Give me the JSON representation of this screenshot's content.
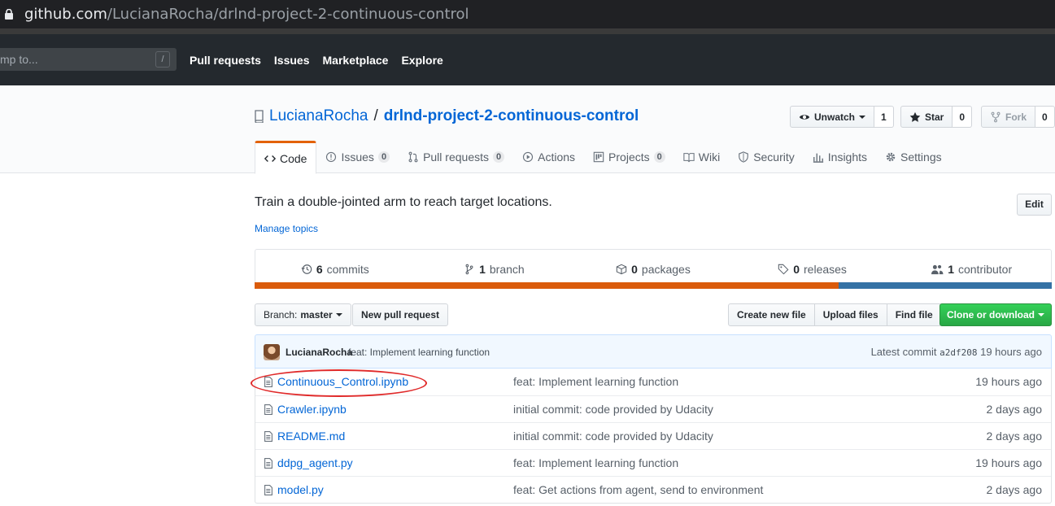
{
  "browser": {
    "url_host": "github.com",
    "url_path": "/LucianaRocha/drlnd-project-2-continuous-control"
  },
  "header": {
    "search_placeholder": "mp to...",
    "search_shortcut": "/",
    "nav": [
      "Pull requests",
      "Issues",
      "Marketplace",
      "Explore"
    ]
  },
  "repo": {
    "owner": "LucianaRocha",
    "separator": "/",
    "name": "drlnd-project-2-continuous-control",
    "unwatch_label": "Unwatch",
    "watch_count": "1",
    "star_label": "Star",
    "star_count": "0",
    "fork_label": "Fork",
    "fork_count": "0"
  },
  "tabs": [
    {
      "label": "Code",
      "icon": "code-icon",
      "counter": null
    },
    {
      "label": "Issues",
      "icon": "issue-icon",
      "counter": "0"
    },
    {
      "label": "Pull requests",
      "icon": "pull-request-icon",
      "counter": "0"
    },
    {
      "label": "Actions",
      "icon": "play-icon",
      "counter": null
    },
    {
      "label": "Projects",
      "icon": "project-icon",
      "counter": "0"
    },
    {
      "label": "Wiki",
      "icon": "book-icon",
      "counter": null
    },
    {
      "label": "Security",
      "icon": "shield-icon",
      "counter": null
    },
    {
      "label": "Insights",
      "icon": "graph-icon",
      "counter": null
    },
    {
      "label": "Settings",
      "icon": "gear-icon",
      "counter": null
    }
  ],
  "about": {
    "description": "Train a double-jointed arm to reach target locations.",
    "manage_topics": "Manage topics",
    "edit_label": "Edit"
  },
  "summary": {
    "commits_num": "6",
    "commits_label": "commits",
    "branch_num": "1",
    "branch_label": "branch",
    "packages_num": "0",
    "packages_label": "packages",
    "releases_num": "0",
    "releases_label": "releases",
    "contributors_num": "1",
    "contributors_label": "contributor"
  },
  "languages": [
    {
      "color": "#da5b0b",
      "share": 0.733
    },
    {
      "color": "#3572a5",
      "share": 0.267
    }
  ],
  "file_nav": {
    "branch_prefix": "Branch:",
    "branch_name": "master",
    "new_pr": "New pull request",
    "create_file": "Create new file",
    "upload_files": "Upload files",
    "find_file": "Find file",
    "clone": "Clone or download"
  },
  "latest_commit": {
    "author": "LucianaRocha",
    "message": "feat: Implement learning function",
    "prefix": "Latest commit",
    "sha": "a2df208",
    "age": "19 hours ago"
  },
  "files": [
    {
      "name": "Continuous_Control.ipynb",
      "message": "feat: Implement learning function",
      "age": "19 hours ago"
    },
    {
      "name": "Crawler.ipynb",
      "message": "initial commit: code provided by Udacity",
      "age": "2 days ago"
    },
    {
      "name": "README.md",
      "message": "initial commit: code provided by Udacity",
      "age": "2 days ago"
    },
    {
      "name": "ddpg_agent.py",
      "message": "feat: Implement learning function",
      "age": "19 hours ago"
    },
    {
      "name": "model.py",
      "message": "feat: Get actions from agent, send to environment",
      "age": "2 days ago"
    }
  ]
}
